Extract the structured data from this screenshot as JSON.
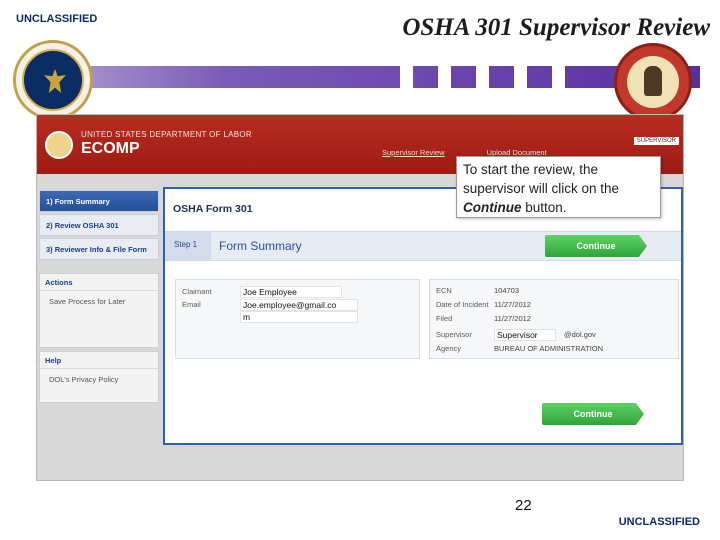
{
  "slide": {
    "classification_top": "UNCLASSIFIED",
    "classification_bottom": "UNCLASSIFIED",
    "title": "OSHA 301 Supervisor Review",
    "page_number": "22",
    "bar_color": "#5a2f9f"
  },
  "app": {
    "department": "UNITED STATES DEPARTMENT OF LABOR",
    "name": "ECOMP",
    "user_tag": "SUPERVISOR",
    "nav_links": [
      "Supervisor Review",
      "Upload Document"
    ],
    "header_color": "#b72c20"
  },
  "left_nav": {
    "items": [
      {
        "label": "1) Form Summary",
        "active": true
      },
      {
        "label": "2) Review OSHA 301",
        "active": false
      },
      {
        "label": "3) Reviewer Info & File Form",
        "active": false
      }
    ],
    "actions_heading": "Actions",
    "actions_link": "Save Process for Later",
    "help_heading": "Help",
    "help_link": "DOL's Privacy Policy"
  },
  "form": {
    "title": "OSHA Form 301",
    "step_label": "Step 1",
    "step_title": "Form Summary",
    "continue_label": "Continue",
    "left_card": {
      "claimant_label": "Claimant",
      "claimant_value": "Joe Employee",
      "email_label": "Email",
      "email_value_1": "Joe.employee@gmail.co",
      "email_value_2": "m"
    },
    "right_card": {
      "case_label": "ECN",
      "case_value": "104703",
      "date_injury_label": "Date of Incident",
      "date_injury_value": "11/27/2012",
      "filed_label": "Filed",
      "filed_value": "11/27/2012",
      "supervisor_label": "Supervisor",
      "supervisor_value": "Supervisor",
      "supervisor_email": "@dol.gov",
      "agency_label": "Agency",
      "agency_value": "BUREAU OF ADMINISTRATION"
    }
  },
  "tooltip": {
    "text_before": "To start the review, the supervisor will click on the",
    "emphasis": "Continue",
    "text_after": "button."
  }
}
